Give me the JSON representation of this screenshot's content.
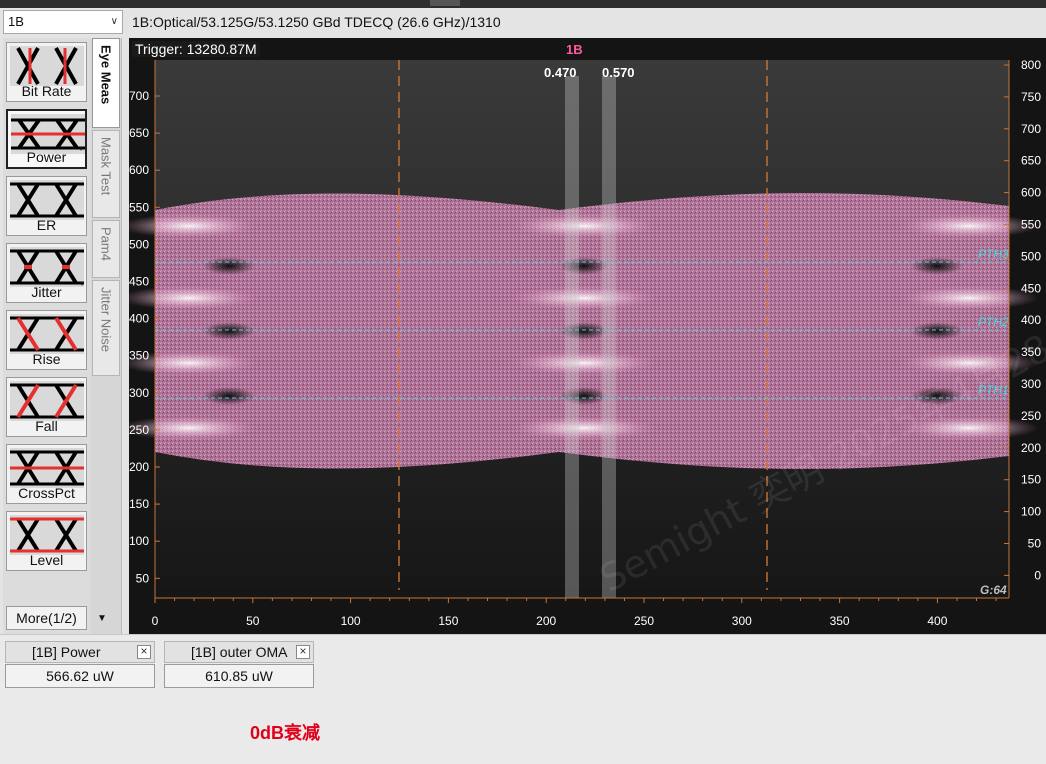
{
  "header": {
    "channel_select": "1B",
    "channel_title": "1B:Optical/53.125G/53.1250 GBd TDECQ (26.6 GHz)/1310"
  },
  "toolbar": {
    "buttons": [
      {
        "label": "Bit Rate",
        "icon": "bitrate-eye-icon",
        "has_dropdown": false
      },
      {
        "label": "Power",
        "icon": "power-eye-icon",
        "has_dropdown": true,
        "selected": true
      },
      {
        "label": "ER",
        "icon": "er-eye-icon",
        "has_dropdown": false
      },
      {
        "label": "Jitter",
        "icon": "jitter-eye-icon",
        "has_dropdown": true
      },
      {
        "label": "Rise",
        "icon": "rise-eye-icon",
        "has_dropdown": false
      },
      {
        "label": "Fall",
        "icon": "fall-eye-icon",
        "has_dropdown": false
      },
      {
        "label": "CrossPct",
        "icon": "crosspct-eye-icon",
        "has_dropdown": false
      },
      {
        "label": "Level",
        "icon": "level-eye-icon",
        "has_dropdown": false
      }
    ],
    "more_label": "More(1/2)",
    "scroll_down": "▼"
  },
  "tabs": [
    "Eye Meas",
    "Mask Test",
    "Pam4",
    "Jitter Noise"
  ],
  "plot": {
    "trigger": "Trigger: 13280.87M",
    "channel_marker": "1B",
    "cursor_labels": [
      "0.470",
      "0.570"
    ],
    "threshold_labels": [
      "PTH3",
      "PTH2",
      "PTH1"
    ],
    "gain_label": "G:64",
    "watermark": "Semight 奕明 2025年4月28日",
    "x_ticks": [
      "0",
      "50",
      "100",
      "150",
      "200",
      "250",
      "300",
      "350",
      "400"
    ],
    "y_left_ticks": [
      "700",
      "650",
      "600",
      "550",
      "500",
      "450",
      "400",
      "350",
      "300",
      "250",
      "200",
      "150",
      "100",
      "50"
    ],
    "y_right_ticks": [
      "800",
      "750",
      "700",
      "650",
      "600",
      "550",
      "500",
      "450",
      "400",
      "350",
      "300",
      "250",
      "200",
      "150",
      "100",
      "50",
      "0"
    ],
    "colors": {
      "eye": "#d98ab8",
      "threshold": "#40d8e0",
      "marker": "#ff5aa0",
      "cursor": "#d97a30",
      "axis": "#c9743a"
    }
  },
  "measurements": [
    {
      "name": "[1B] Power",
      "value": "566.62 uW"
    },
    {
      "name": "[1B] outer OMA",
      "value": "610.85 uW"
    }
  ],
  "note": "0dB衰减"
}
